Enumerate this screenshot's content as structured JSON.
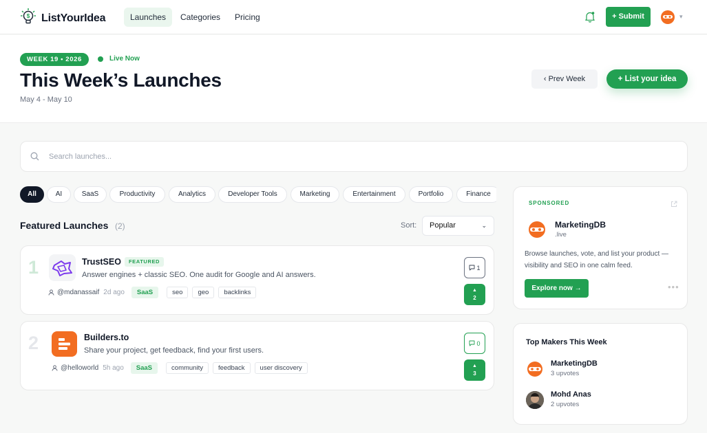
{
  "nav": {
    "brand": "ListYourIdea",
    "links": [
      {
        "label": "Launches",
        "active": true
      },
      {
        "label": "Categories",
        "active": false
      },
      {
        "label": "Pricing",
        "active": false
      }
    ],
    "submit_label": "+ Submit",
    "icons": {
      "logo": "lightbulb-dollar-icon",
      "notifications": "bell-icon",
      "avatar": "avatar-robot-icon",
      "menu": "chevron-down-icon"
    }
  },
  "hero": {
    "week_badge": "WEEK 19 • 2026",
    "live_label": "Live Now",
    "title": "This Week’s Launches",
    "date_range": "May 4 - May 10",
    "prev_label": "‹  Prev Week",
    "list_label": "+  List your idea"
  },
  "search": {
    "placeholder": "Search launches..."
  },
  "categories": [
    {
      "label": "All",
      "active": true
    },
    {
      "label": "AI"
    },
    {
      "label": "SaaS"
    },
    {
      "label": "Productivity"
    },
    {
      "label": "Analytics"
    },
    {
      "label": "Developer Tools"
    },
    {
      "label": "Marketing"
    },
    {
      "label": "Entertainment"
    },
    {
      "label": "Portfolio"
    },
    {
      "label": "Finance"
    }
  ],
  "featured": {
    "title": "Featured Launches",
    "count": "(2)",
    "sort_label": "Sort:",
    "sort_value": "Popular"
  },
  "launches": [
    {
      "rank": "1",
      "name": "TrustSEO",
      "badge": "FEATURED",
      "description": "Answer engines + classic SEO. One audit for Google and AI answers.",
      "maker": "@mdanassaif",
      "time": "2d ago",
      "category": "SaaS",
      "tags": [
        "seo",
        "geo",
        "backlinks"
      ],
      "comments": "1",
      "votes": "2"
    },
    {
      "rank": "2",
      "name": "Builders.to",
      "description": "Share your project, get feedback, find your first users.",
      "maker": "@helloworld",
      "time": "5h ago",
      "category": "SaaS",
      "tags": [
        "community",
        "feedback",
        "user discovery"
      ],
      "comments": "0",
      "votes": "3"
    }
  ],
  "sponsored": {
    "label": "SPONSORED",
    "name": "MarketingDB",
    "domain": ".live",
    "description": "Browse launches, vote, and list your product — visibility and SEO in one calm feed.",
    "cta": "Explore now →"
  },
  "top_makers": {
    "title": "Top Makers This Week",
    "makers": [
      {
        "name": "MarketingDB",
        "votes": "3 upvotes"
      },
      {
        "name": "Mohd Anas",
        "votes": "2 upvotes"
      }
    ]
  },
  "colors": {
    "accent": "#22a052",
    "accent_light": "#e7f6ec",
    "text": "#111827",
    "orange": "#f26d21"
  }
}
